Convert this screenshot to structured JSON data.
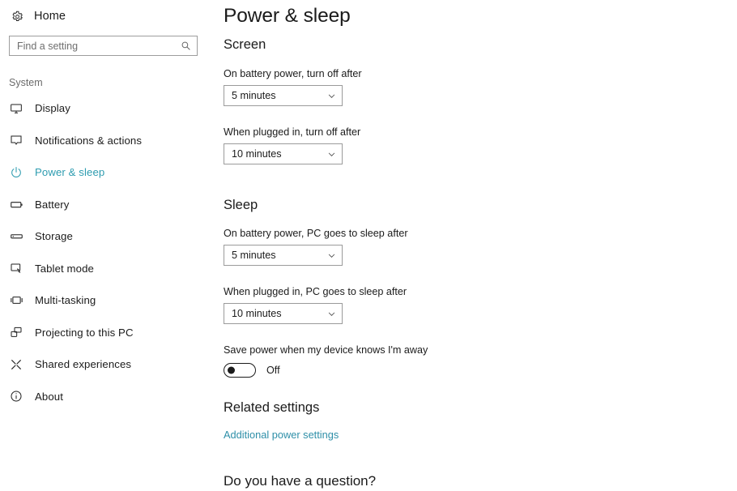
{
  "sidebar": {
    "home": {
      "label": "Home",
      "icon": "gear-icon"
    },
    "search": {
      "placeholder": "Find a setting",
      "value": "",
      "icon": "search-icon"
    },
    "category_label": "System",
    "items": [
      {
        "label": "Display",
        "icon": "monitor-icon",
        "active": false
      },
      {
        "label": "Notifications & actions",
        "icon": "notification-icon",
        "active": false
      },
      {
        "label": "Power & sleep",
        "icon": "power-icon",
        "active": true
      },
      {
        "label": "Battery",
        "icon": "battery-icon",
        "active": false
      },
      {
        "label": "Storage",
        "icon": "storage-icon",
        "active": false
      },
      {
        "label": "Tablet mode",
        "icon": "tablet-icon",
        "active": false
      },
      {
        "label": "Multi-tasking",
        "icon": "multitasking-icon",
        "active": false
      },
      {
        "label": "Projecting to this PC",
        "icon": "projecting-icon",
        "active": false
      },
      {
        "label": "Shared experiences",
        "icon": "shared-icon",
        "active": false
      },
      {
        "label": "About",
        "icon": "info-icon",
        "active": false
      }
    ]
  },
  "main": {
    "title": "Power & sleep",
    "screen": {
      "heading": "Screen",
      "battery_label": "On battery power, turn off after",
      "battery_value": "5 minutes",
      "plugged_label": "When plugged in, turn off after",
      "plugged_value": "10 minutes"
    },
    "sleep": {
      "heading": "Sleep",
      "battery_label": "On battery power, PC goes to sleep after",
      "battery_value": "5 minutes",
      "plugged_label": "When plugged in, PC goes to sleep after",
      "plugged_value": "10 minutes",
      "save_power_label": "Save power when my device knows I'm away",
      "save_power_state": "Off"
    },
    "related": {
      "heading": "Related settings",
      "link_label": "Additional power settings"
    },
    "question_heading": "Do you have a question?"
  },
  "colors": {
    "accent": "#2e9cb0",
    "link": "#2e8fa8",
    "text": "#1b1b1b",
    "border": "#9b9b9b"
  }
}
